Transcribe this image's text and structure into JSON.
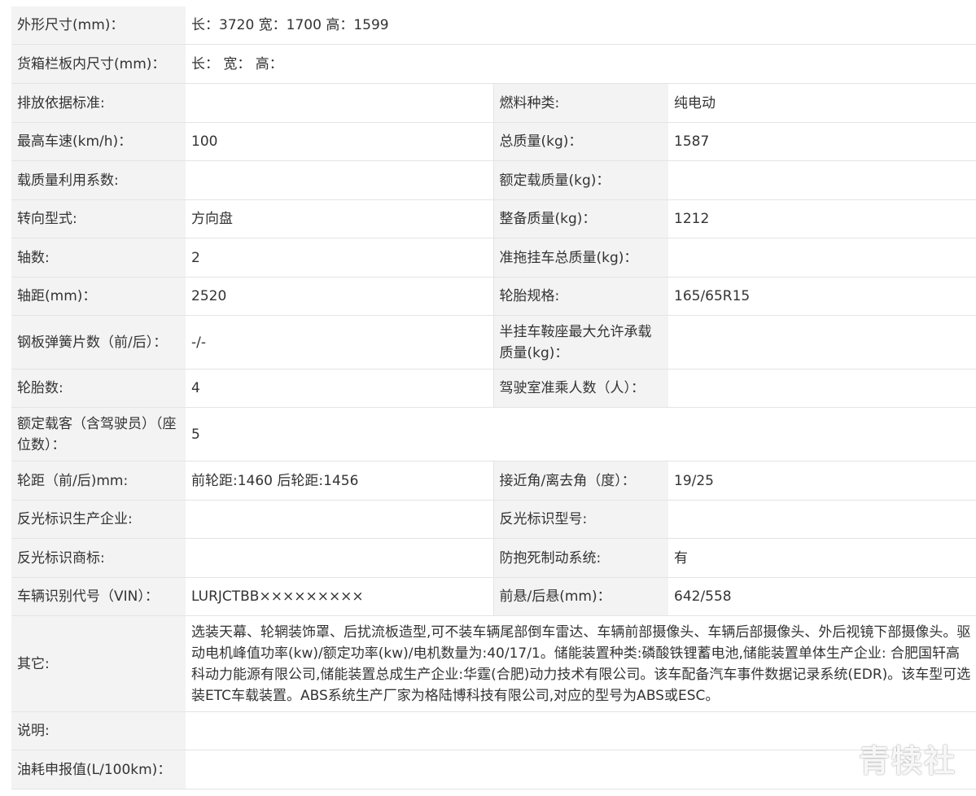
{
  "rows": {
    "dims": {
      "label": "外形尺寸(mm)：",
      "value": "长：3720 宽：1700 高：1599"
    },
    "cargo": {
      "label": "货箱栏板内尺寸(mm)：",
      "value": "长： 宽： 高："
    },
    "emission": {
      "label": "排放依据标准:",
      "value": "",
      "label2": "燃料种类:",
      "value2": "纯电动"
    },
    "speed": {
      "label": "最高车速(km/h)：",
      "value": "100",
      "label2": "总质量(kg)：",
      "value2": "1587"
    },
    "loadfactor": {
      "label": "载质量利用系数:",
      "value": "",
      "label2": "额定载质量(kg)：",
      "value2": ""
    },
    "steering": {
      "label": "转向型式:",
      "value": "方向盘",
      "label2": "整备质量(kg)：",
      "value2": "1212"
    },
    "axles": {
      "label": "轴数:",
      "value": "2",
      "label2": "准拖挂车总质量(kg)：",
      "value2": ""
    },
    "wheelbase": {
      "label": "轴距(mm)：",
      "value": "2520",
      "label2": "轮胎规格:",
      "value2": "165/65R15"
    },
    "springs": {
      "label": "钢板弹簧片数（前/后）：",
      "value": "-/-",
      "label2": "半挂车鞍座最大允许承载质量(kg)：",
      "value2": ""
    },
    "tires": {
      "label": "轮胎数:",
      "value": "4",
      "label2": "驾驶室准乘人数（人）：",
      "value2": ""
    },
    "seats": {
      "label": "额定载客（含驾驶员）（座位数）：",
      "value": "5"
    },
    "track": {
      "label": "轮距（前/后)mm:",
      "value": "前轮距:1460 后轮距:1456",
      "label2": "接近角/离去角（度）：",
      "value2": "19/25"
    },
    "reflmaker": {
      "label": "反光标识生产企业:",
      "value": "",
      "label2": "反光标识型号:",
      "value2": ""
    },
    "reflbrand": {
      "label": "反光标识商标:",
      "value": "",
      "label2": "防抱死制动系统:",
      "value2": "有"
    },
    "vin": {
      "label": "车辆识别代号（VIN）：",
      "value": "LURJCTBB×××××××××",
      "label2": "前悬/后悬(mm)：",
      "value2": "642/558"
    },
    "other": {
      "label": "其它:",
      "value": "选装天幕、轮辋装饰罩、后扰流板造型,可不装车辆尾部倒车雷达、车辆前部摄像头、车辆后部摄像头、外后视镜下部摄像头。驱动电机峰值功率(kw)/额定功率(kw)/电机数量为:40/17/1。储能装置种类:磷酸铁锂蓄电池,储能装置单体生产企业: 合肥国轩高科动力能源有限公司,储能装置总成生产企业:华霆(合肥)动力技术有限公司。该车配备汽车事件数据记录系统(EDR)。该车型可选装ETC车载装置。ABS系统生产厂家为格陆博科技有限公司,对应的型号为ABS或ESC。"
    },
    "note": {
      "label": "说明:",
      "value": ""
    },
    "fuel": {
      "label": "油耗申报值(L/100km)：",
      "value": ""
    }
  },
  "watermark": "青犊社"
}
